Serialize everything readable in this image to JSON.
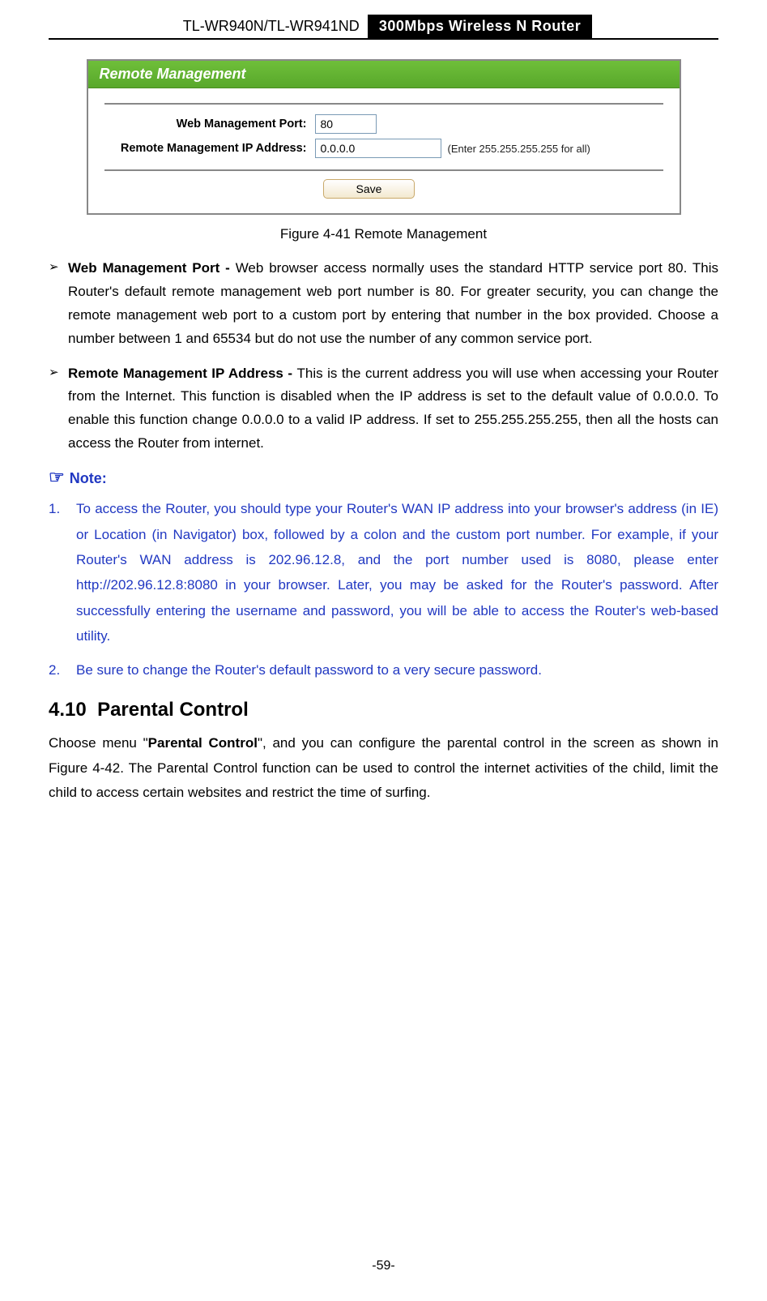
{
  "header": {
    "model": "TL-WR940N/TL-WR941ND",
    "product": "300Mbps Wireless N Router"
  },
  "figure": {
    "titlebar": "Remote Management",
    "rows": {
      "port_label": "Web Management Port:",
      "port_value": "80",
      "ip_label": "Remote Management IP Address:",
      "ip_value": "0.0.0.0",
      "ip_hint": "(Enter 255.255.255.255 for all)"
    },
    "save_label": "Save",
    "caption": "Figure 4-41 Remote Management"
  },
  "bullets": [
    {
      "bold": "Web Management Port - ",
      "rest": "Web browser access normally uses the standard HTTP service port 80. This Router's default remote management web port number is 80. For greater security, you can change the remote management web port to a custom port by entering that number in the box provided. Choose a number between 1 and 65534 but do not use the number of any common service port."
    },
    {
      "bold": "Remote Management IP Address - ",
      "rest": "This is the current address you will use when accessing your Router from the Internet. This function is disabled when the IP address is set to the default value of 0.0.0.0. To enable this function change 0.0.0.0 to a valid IP address. If set to 255.255.255.255, then all the hosts can access the Router from internet."
    }
  ],
  "note": {
    "label": "Note:",
    "items": [
      "To access the Router, you should type your Router's WAN IP address into your browser's address (in IE) or Location (in Navigator) box, followed by a colon and the custom port number. For example, if your Router's WAN address is 202.96.12.8, and the port number used is 8080, please enter http://202.96.12.8:8080 in your browser. Later, you may be asked for the Router's password. After successfully entering the username and password, you will be able to access the Router's web-based utility.",
      "Be sure to change the Router's default password to a very secure password."
    ]
  },
  "section": {
    "number": "4.10",
    "title": "Parental Control",
    "para_pre": "Choose menu \"",
    "para_bold": "Parental Control",
    "para_post": "\", and you can configure the parental control in the screen as shown in Figure 4-42. The Parental Control function can be used to control the internet activities of the child, limit the child to access certain websites and restrict the time of surfing."
  },
  "page_number": "-59-"
}
